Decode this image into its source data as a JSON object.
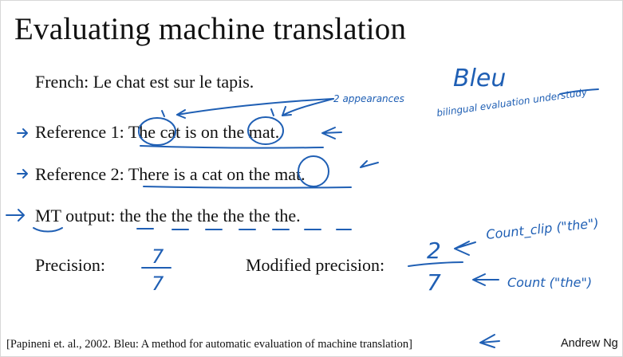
{
  "slide": {
    "title": "Evaluating machine translation",
    "french": "French: Le chat est sur le tapis.",
    "reference1": "Reference 1: The cat is on the mat.",
    "reference2": "Reference 2: There is a cat on the mat.",
    "mt_output": "MT output: the the the the the the the.",
    "precision_label": "Precision:",
    "modified_precision_label": "Modified precision:",
    "citation": "[Papineni et. al., 2002. Bleu: A method for automatic evaluation of machine translation]",
    "author": "Andrew Ng"
  },
  "annotations": {
    "bleu": "Bleu",
    "bleu_expansion": "bilingual evaluation understudy",
    "appearances": "2 appearances",
    "precision_numerator": "7",
    "precision_denominator": "7",
    "modified_numerator": "2",
    "modified_denominator": "7",
    "count_clip": "Count_clip (\"the\")",
    "count": "Count (\"the\")"
  },
  "colors": {
    "ink": "#1f5fb4",
    "text": "#111111",
    "background": "#ffffff"
  }
}
